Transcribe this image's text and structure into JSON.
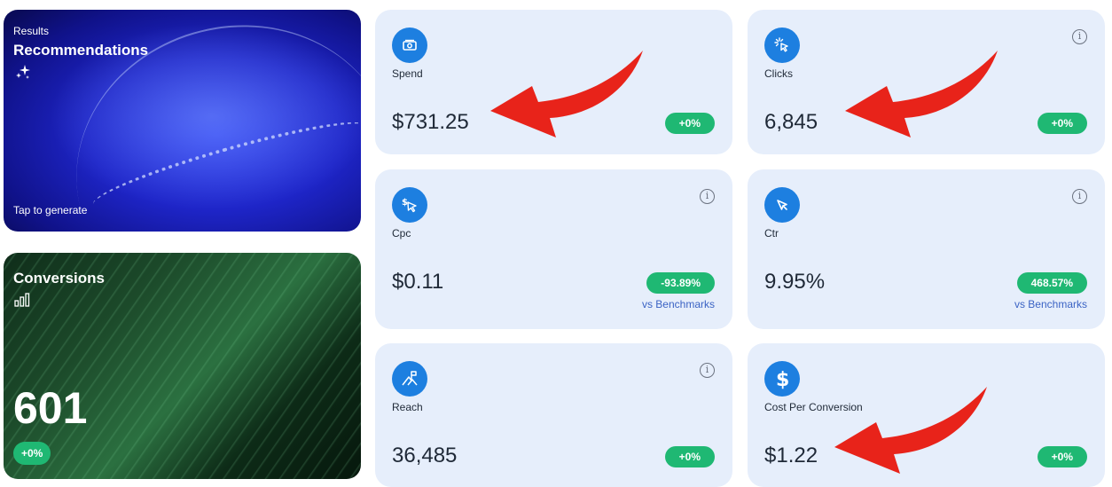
{
  "recommendations": {
    "eyebrow": "Results",
    "title": "Recommendations",
    "cta": "Tap to generate",
    "icon": "sparkle-icon"
  },
  "conversions": {
    "title": "Conversions",
    "value": "601",
    "change": "+0%",
    "icon": "bar-chart-icon"
  },
  "metrics": {
    "spend": {
      "label": "Spend",
      "value": "$731.25",
      "change": "+0%",
      "icon": "money-icon"
    },
    "clicks": {
      "label": "Clicks",
      "value": "6,845",
      "change": "+0%",
      "icon": "cursor-click-icon"
    },
    "cpc": {
      "label": "Cpc",
      "value": "$0.11",
      "change": "-93.89%",
      "benchmark": "vs Benchmarks",
      "icon": "dollar-cursor-icon"
    },
    "ctr": {
      "label": "Ctr",
      "value": "9.95%",
      "change": "468.57%",
      "benchmark": "vs Benchmarks",
      "icon": "cursor-icon"
    },
    "reach": {
      "label": "Reach",
      "value": "36,485",
      "change": "+0%",
      "icon": "flag-mountain-icon"
    },
    "cost_per_conversion": {
      "label": "Cost Per Conversion",
      "value": "$1.22",
      "change": "+0%",
      "icon": "dollar-icon"
    }
  },
  "colors": {
    "card_bg": "#e6eefb",
    "icon_blue": "#1d7fe0",
    "badge_green": "#1fb873",
    "link_blue": "#3b63c4",
    "arrow_red": "#e8231a"
  }
}
